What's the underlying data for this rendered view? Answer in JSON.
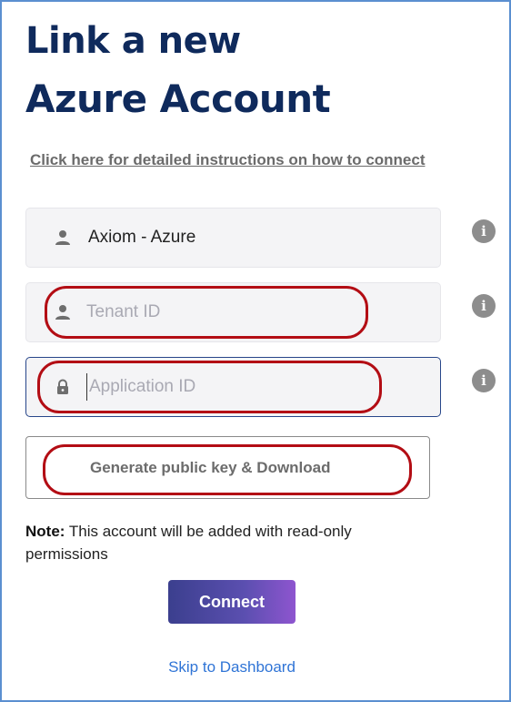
{
  "header": {
    "title_line1": "Link a new",
    "title_line2": "Azure Account"
  },
  "instructions_link": "Click here for detailed instructions on how to connect",
  "fields": {
    "account_name": {
      "value": "Axiom - Azure",
      "icon": "user-icon"
    },
    "tenant_id": {
      "placeholder": "Tenant ID",
      "icon": "user-icon"
    },
    "application_id": {
      "placeholder": "Application ID",
      "icon": "lock-icon"
    }
  },
  "info_icon_glyph": "i",
  "generate_button": "Generate public key & Download",
  "note": {
    "label": "Note:",
    "text": " This account will be added with read-only permissions"
  },
  "connect_button": "Connect",
  "skip_link": "Skip to Dashboard",
  "colors": {
    "title": "#0f2a5c",
    "link": "#2f74d6",
    "annotation": "#b30d14",
    "focus_border": "#27468a"
  }
}
